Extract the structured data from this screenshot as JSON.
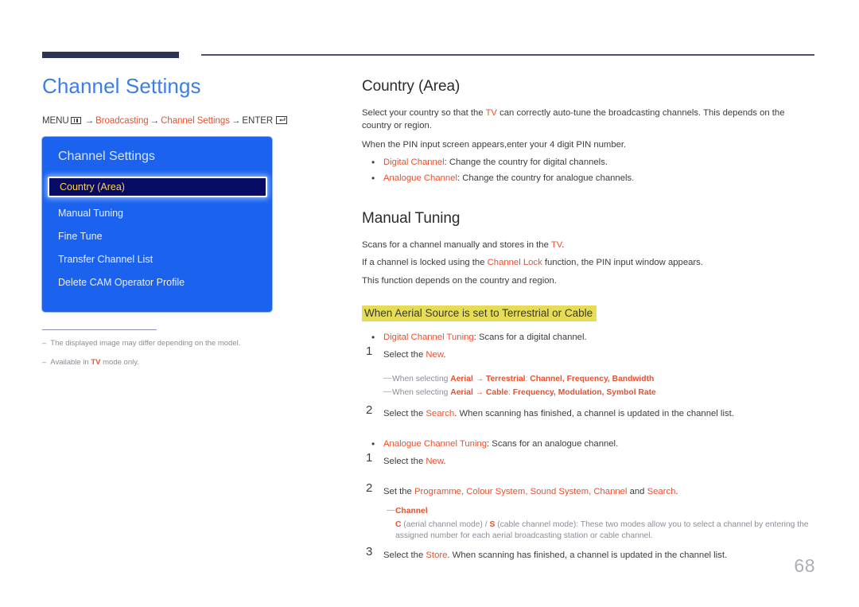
{
  "header": {
    "rule_color": "#2e3352"
  },
  "left": {
    "page_title": "Channel Settings",
    "menu_path": {
      "menu_label": "MENU",
      "arrow": "→",
      "item1": "Broadcasting",
      "item2": "Channel Settings",
      "enter_label": "ENTER",
      "menu_icon": "menu-grid-icon",
      "enter_icon": "enter-return-icon"
    },
    "osd": {
      "title": "Channel Settings",
      "items": [
        {
          "label": "Country (Area)",
          "selected": true
        },
        {
          "label": "Manual Tuning",
          "selected": false
        },
        {
          "label": "Fine Tune",
          "selected": false
        },
        {
          "label": "Transfer Channel List",
          "selected": false
        },
        {
          "label": "Delete CAM Operator Profile",
          "selected": false
        }
      ],
      "bg_color": "#1b63ef",
      "selected_bg": "#070b63",
      "selected_text_color": "#ffd24d"
    },
    "footnotes": [
      {
        "dash": "–",
        "text": "The displayed image may differ depending on the model."
      },
      {
        "dash": "–",
        "pre": "Available in ",
        "hl": "TV",
        "post": " mode only."
      }
    ]
  },
  "right": {
    "section1": {
      "heading": "Country (Area)",
      "para1_a": "Select your country so that the ",
      "para1_hl": "TV",
      "para1_b": " can correctly auto-tune the broadcasting channels. This depends on the country or region.",
      "para2": "When the PIN input screen appears,enter your 4 digit PIN number.",
      "bullets": [
        {
          "hl": "Digital Channel",
          "text": ": Change the country for digital channels."
        },
        {
          "hl": "Analogue Channel",
          "text": ": Change the country for analogue channels."
        }
      ]
    },
    "section2": {
      "heading": "Manual Tuning",
      "para1_a": "Scans for a channel manually and stores in the ",
      "para1_hl": "TV",
      "para1_b": ".",
      "para2_a": "If a channel is locked using the ",
      "para2_hl": "Channel Lock",
      "para2_b": " function, the PIN input window appears.",
      "para3": "This function depends on the country and region.",
      "yellow_heading": "When Aerial Source is set to Terrestrial or Cable",
      "digital_bullet": {
        "hl": "Digital Channel Tuning",
        "text": ": Scans for a digital channel."
      },
      "digital_steps": [
        {
          "num": "1",
          "pre": "Select the ",
          "hl": "New",
          "post": "."
        },
        {
          "num": "2",
          "pre": "Select the ",
          "hl": "Search",
          "post": ". When scanning has finished, a channel is updated in the channel list."
        }
      ],
      "digital_subnotes": [
        {
          "dash": "—",
          "pre": "When selecting ",
          "b1": "Aerial",
          "arrow": " → ",
          "b2": "Terrestrial",
          "mid": ": ",
          "tail": "Channel, Frequency, Bandwidth"
        },
        {
          "dash": "—",
          "pre": "When selecting ",
          "b1": "Aerial",
          "arrow": " → ",
          "b2": "Cable",
          "mid": ": ",
          "tail": "Frequency, Modulation, Symbol Rate"
        }
      ],
      "analogue_bullet": {
        "hl": "Analogue Channel Tuning",
        "text": ": Scans for an analogue channel."
      },
      "analogue_steps": [
        {
          "num": "1",
          "pre": "Select the ",
          "hl": "New",
          "post": "."
        },
        {
          "num": "2",
          "pre": "Set the ",
          "hl": "Programme, Colour System, Sound System, Channel",
          "mid": " and ",
          "hl2": "Search",
          "post": "."
        },
        {
          "num": "3",
          "pre": "Select the ",
          "hl": "Store",
          "post": ". When scanning has finished, a channel is updated in the channel list."
        }
      ],
      "channel_subnote": {
        "dash": "—",
        "label": "Channel"
      },
      "channel_desc": {
        "c": "C",
        "c_text": " (aerial channel mode) / ",
        "s": "S",
        "s_text": " (cable channel mode): These two modes allow you to select a channel by entering the assigned number for each aerial broadcasting station or cable channel."
      }
    }
  },
  "page_number": "68"
}
